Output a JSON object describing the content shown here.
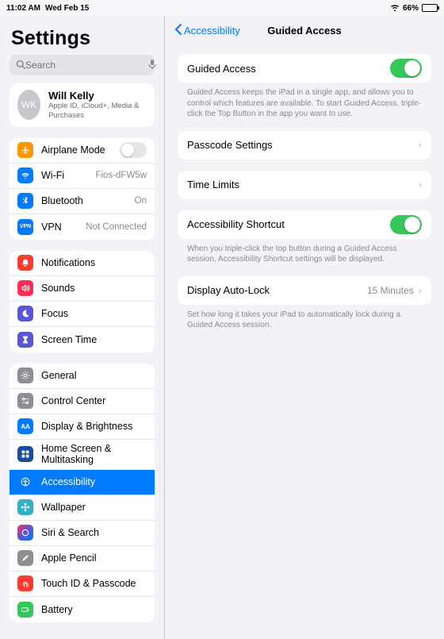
{
  "status": {
    "time": "11:02 AM",
    "date": "Wed Feb 15",
    "battery_pct": "66%"
  },
  "sidebar": {
    "title": "Settings",
    "search_placeholder": "Search",
    "profile": {
      "initials": "WK",
      "name": "Will Kelly",
      "sub": "Apple ID, iCloud+, Media & Purchases"
    },
    "group1": {
      "airplane": "Airplane Mode",
      "wifi": "Wi-Fi",
      "wifi_val": "Fios-dFW5w",
      "bluetooth": "Bluetooth",
      "bluetooth_val": "On",
      "vpn": "VPN",
      "vpn_val": "Not Connected"
    },
    "group2": {
      "notifications": "Notifications",
      "sounds": "Sounds",
      "focus": "Focus",
      "screentime": "Screen Time"
    },
    "group3": {
      "general": "General",
      "control_center": "Control Center",
      "display": "Display & Brightness",
      "home": "Home Screen & Multitasking",
      "accessibility": "Accessibility",
      "wallpaper": "Wallpaper",
      "siri": "Siri & Search",
      "pencil": "Apple Pencil",
      "touchid": "Touch ID & Passcode",
      "battery": "Battery"
    }
  },
  "detail": {
    "back": "Accessibility",
    "title": "Guided Access",
    "guided_access": "Guided Access",
    "guided_access_footer": "Guided Access keeps the iPad in a single app, and allows you to control which features are available. To start Guided Access, triple-click the Top Button in the app you want to use.",
    "passcode": "Passcode Settings",
    "time_limits": "Time Limits",
    "shortcut": "Accessibility Shortcut",
    "shortcut_footer": "When you triple-click the top button during a Guided Access session, Accessibility Shortcut settings will be displayed.",
    "autolock": "Display Auto-Lock",
    "autolock_val": "15 Minutes",
    "autolock_footer": "Set how long it takes your iPad to automatically lock during a Guided Access session."
  }
}
